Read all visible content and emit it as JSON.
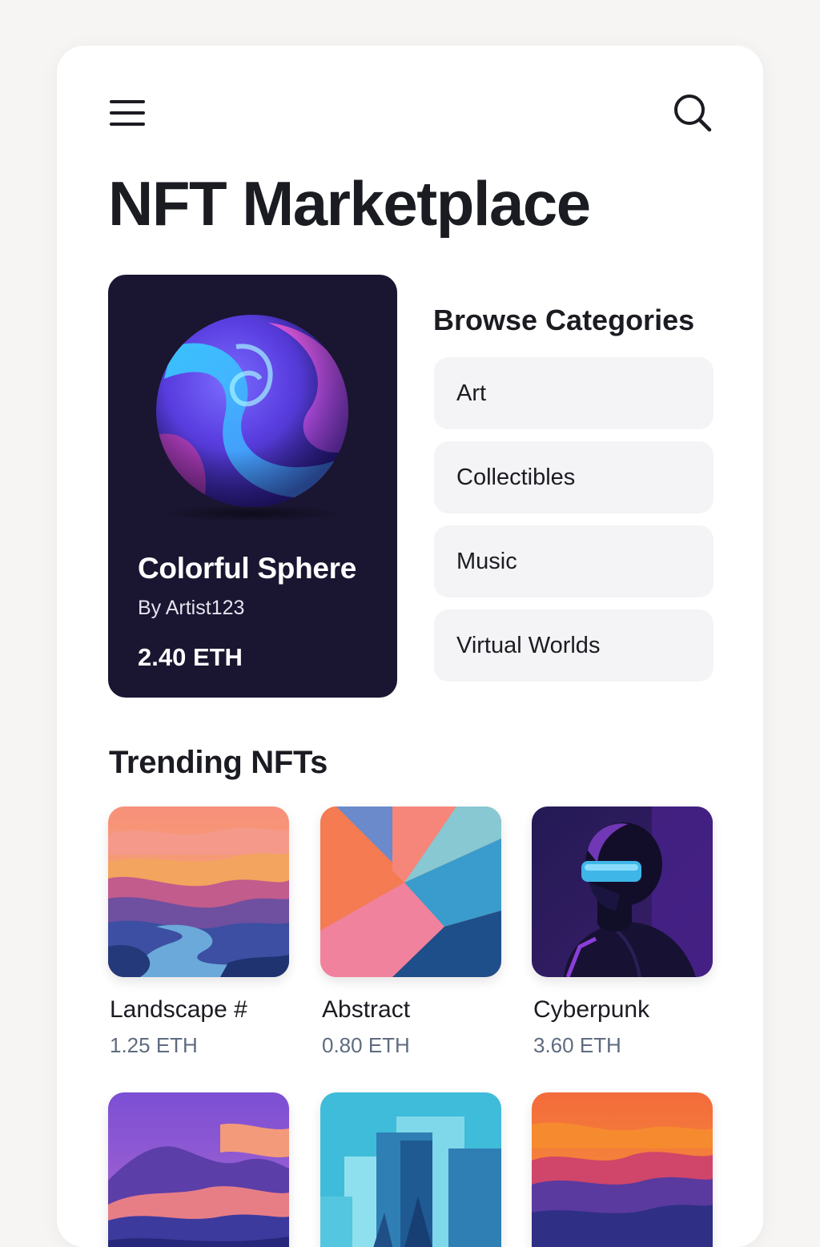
{
  "header": {
    "title": "NFT Marketplace",
    "menu_icon": "hamburger-menu-icon",
    "search_icon": "search-icon"
  },
  "featured": {
    "name": "Colorful Sphere",
    "artist": "By Artist123",
    "price": "2.40 ETH",
    "image": "colorful-swirl-sphere",
    "background_color": "#1a1530"
  },
  "categories": {
    "heading": "Browse Categories",
    "items": [
      {
        "label": "Art"
      },
      {
        "label": "Collectibles"
      },
      {
        "label": "Music"
      },
      {
        "label": "Virtual Worlds"
      }
    ]
  },
  "trending": {
    "heading": "Trending NFTs",
    "items": [
      {
        "name": "Landscape #",
        "price": "1.25 ETH",
        "image": "sunset-landscape-river"
      },
      {
        "name": "Abstract",
        "price": "0.80 ETH",
        "image": "geometric-abstract"
      },
      {
        "name": "Cyberpunk",
        "price": "3.60 ETH",
        "image": "cyberpunk-figure-visor"
      },
      {
        "name": "",
        "price": "",
        "image": "purple-mountains"
      },
      {
        "name": "",
        "price": "",
        "image": "blue-city-skyline"
      },
      {
        "name": "",
        "price": "",
        "image": "orange-sunset-mountains"
      }
    ]
  },
  "colors": {
    "page_background": "#f6f5f3",
    "card_background": "#ffffff",
    "text_primary": "#1b1c22",
    "text_muted_price": "#5f6b80",
    "category_button": "#f4f4f6"
  }
}
